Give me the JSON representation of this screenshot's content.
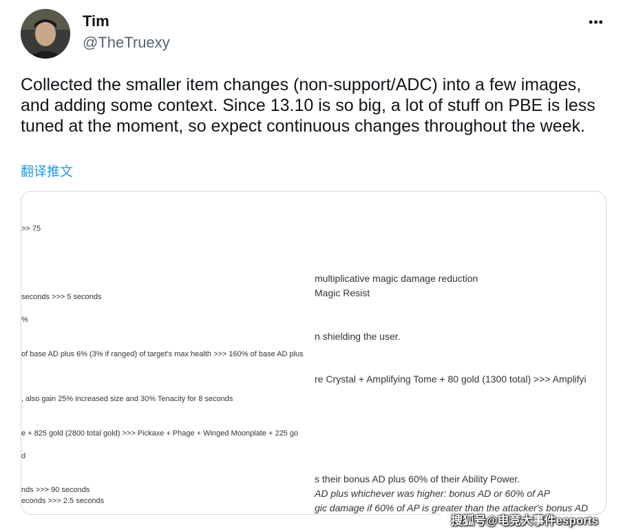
{
  "author": {
    "display_name": "Tim",
    "handle": "@TheTruexy"
  },
  "more_icon": "•••",
  "tweet": {
    "text": "Collected the smaller item changes (non-support/ADC) into a few images, and adding some context. Since 13.10 is so big, a lot of stuff on PBE is less tuned at the moment, so expect continuous changes throughout the week.",
    "translate_label": "翻译推文"
  },
  "media": {
    "left_lines": [
      ">> 75",
      " seconds >>> 5 seconds",
      "%",
      "of base AD plus 6% (3% if ranged) of target's max health >>> 160% of base AD plus",
      ", also gain 25% increased size and 30% Tenacity for 8 seconds",
      "e + 825 gold (2800 total gold) >>> Pickaxe + Phage + Winged Moonplate + 225 go",
      "d",
      "nds >>> 90 seconds",
      "econds >>> 2.5 seconds"
    ],
    "right_lines": [
      "multiplicative magic damage reduction",
      "Magic Resist",
      "n shielding the user.",
      "re Crystal + Amplifying Tome + 80 gold (1300 total) >>> Amplifyi",
      "s their bonus AD plus 60% of their Ability Power.",
      "AD plus whichever was higher: bonus AD or 60% of AP",
      "gic damage if 60% of AP is greater than the attacker's bonus AD"
    ]
  },
  "watermark": {
    "text": "搜狐号@电竞大事件esports"
  }
}
